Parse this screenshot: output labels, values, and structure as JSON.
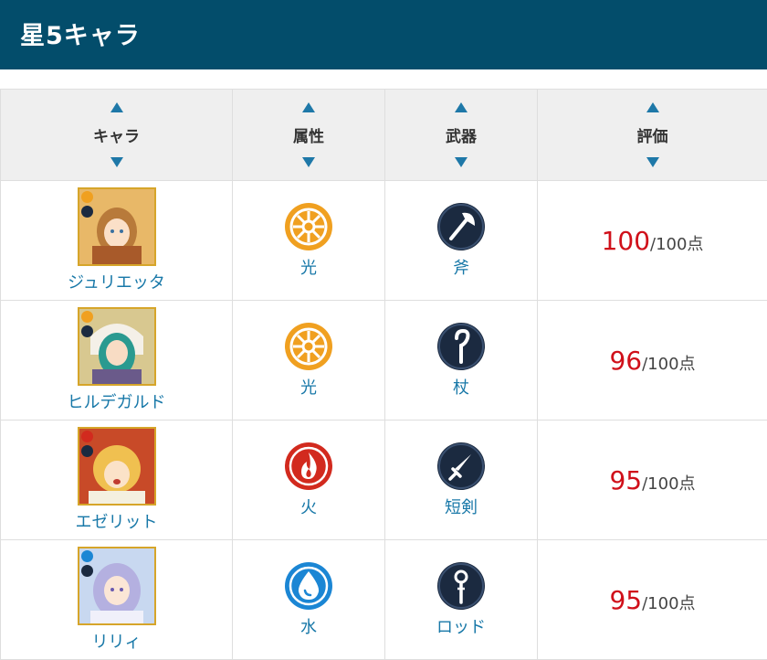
{
  "header": {
    "title": "星5キャラ"
  },
  "columns": {
    "character": "キャラ",
    "element": "属性",
    "weapon": "武器",
    "rating": "評価"
  },
  "rows": [
    {
      "name": "ジュリエッタ",
      "element": "光",
      "weapon": "斧",
      "score": "100",
      "max": "/100点",
      "element_icon": "light-element-icon",
      "weapon_icon": "axe-icon"
    },
    {
      "name": "ヒルデガルド",
      "element": "光",
      "weapon": "杖",
      "score": "96",
      "max": "/100点",
      "element_icon": "light-element-icon",
      "weapon_icon": "staff-icon"
    },
    {
      "name": "エゼリット",
      "element": "火",
      "weapon": "短剣",
      "score": "95",
      "max": "/100点",
      "element_icon": "fire-element-icon",
      "weapon_icon": "dagger-icon"
    },
    {
      "name": "リリィ",
      "element": "水",
      "weapon": "ロッド",
      "score": "95",
      "max": "/100点",
      "element_icon": "water-element-icon",
      "weapon_icon": "rod-icon"
    }
  ],
  "colors": {
    "header_bg": "#034d6b",
    "link": "#1878a8",
    "score": "#d0101a",
    "light": "#f0a020",
    "fire": "#d22a1e",
    "water": "#1b86d4",
    "weapon_bg": "#1b2a40"
  }
}
